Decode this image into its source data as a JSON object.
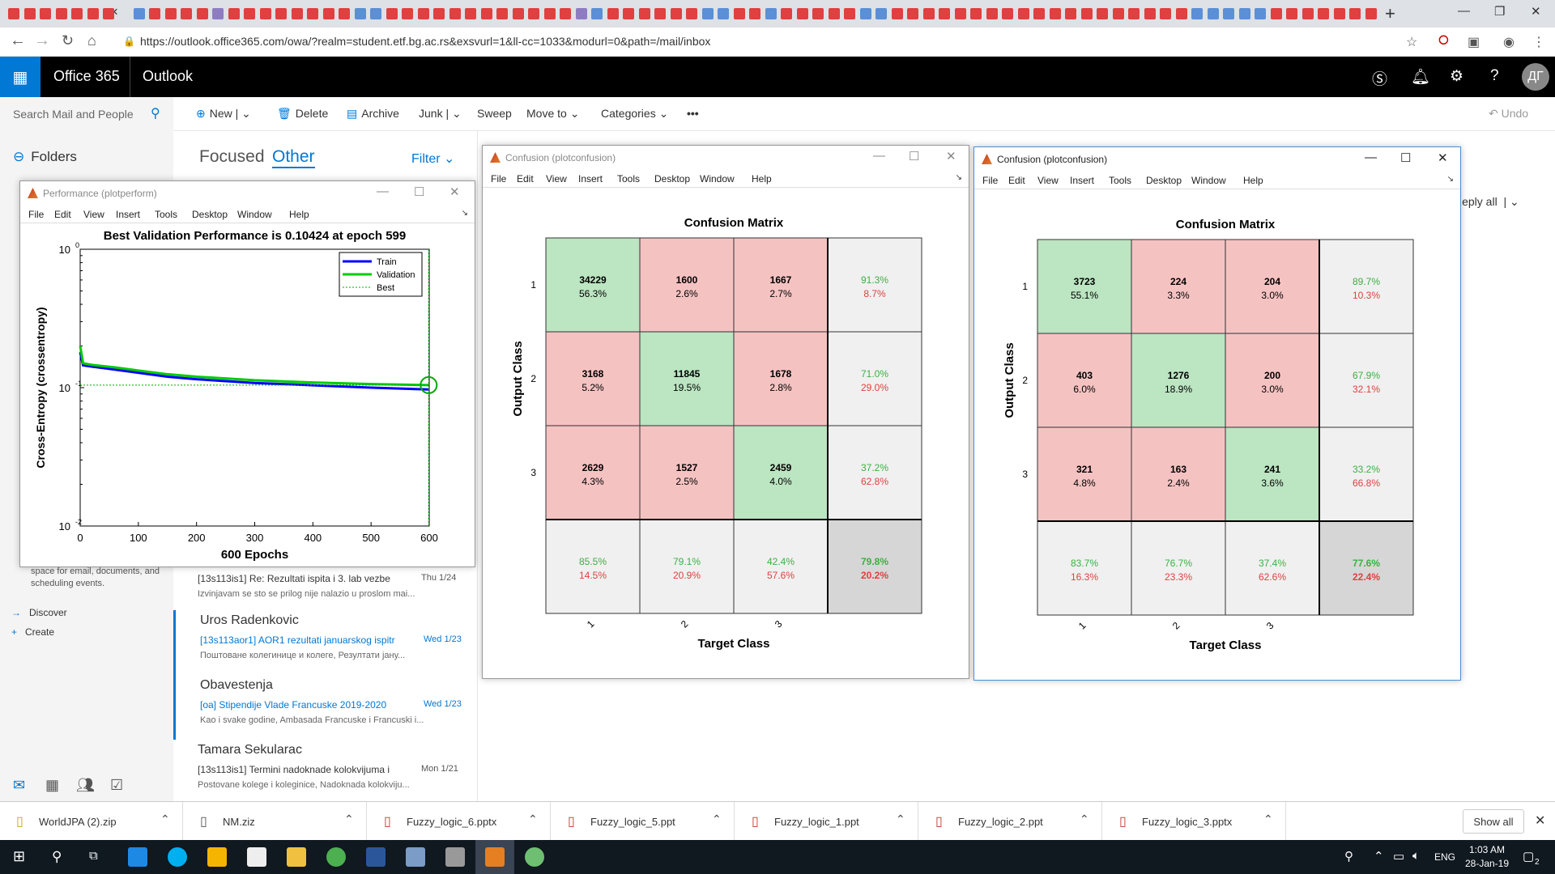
{
  "browser": {
    "url": "https://outlook.office365.com/owa/?realm=student.etf.bg.ac.rs&exsvurl=1&ll-cc=1033&modurl=0&path=/mail/inbox",
    "tab_colors": [
      "#e04040",
      "#e04040",
      "#e04040",
      "#e04040",
      "#e04040",
      "#e04040",
      "#e04040",
      "#5b8fd6",
      "#e04040",
      "#e04040",
      "#e04040",
      "#e04040",
      "#8e7cc3",
      "#e04040",
      "#e04040",
      "#e04040",
      "#e04040",
      "#e04040",
      "#e04040",
      "#e04040",
      "#e04040",
      "#5b8fd6",
      "#5b8fd6",
      "#e04040",
      "#e04040",
      "#e04040",
      "#e04040",
      "#e04040",
      "#e04040",
      "#e04040",
      "#e04040",
      "#e04040",
      "#e04040",
      "#e04040",
      "#e04040",
      "#8e7cc3",
      "#5b8fd6",
      "#e04040",
      "#e04040",
      "#e04040",
      "#e04040",
      "#e04040",
      "#e04040",
      "#5b8fd6",
      "#5b8fd6",
      "#e04040",
      "#e04040",
      "#5b8fd6",
      "#e04040",
      "#e04040",
      "#e04040",
      "#e04040",
      "#e04040",
      "#5b8fd6",
      "#5b8fd6",
      "#e04040",
      "#e04040",
      "#e04040",
      "#e04040",
      "#e04040",
      "#e04040",
      "#e04040",
      "#e04040",
      "#e04040",
      "#e04040",
      "#e04040",
      "#e04040",
      "#e04040",
      "#e04040",
      "#e04040",
      "#e04040",
      "#e04040",
      "#e04040",
      "#e04040",
      "#5b8fd6",
      "#5b8fd6",
      "#5b8fd6",
      "#5b8fd6",
      "#5b8fd6",
      "#e04040",
      "#e04040",
      "#e04040",
      "#e04040",
      "#e04040",
      "#e04040",
      "#e04040",
      "#e04040",
      "#e04040",
      "#e04040",
      "#e04040",
      "#e04040"
    ]
  },
  "o365": {
    "brand": "Office 365",
    "app": "Outlook",
    "avatar_initials": "ДГ"
  },
  "search": {
    "placeholder": "Search Mail and People"
  },
  "commands": {
    "new": "New",
    "delete": "Delete",
    "archive": "Archive",
    "junk": "Junk",
    "sweep": "Sweep",
    "move_to": "Move to",
    "categories": "Categories",
    "more": "•••",
    "undo": "Undo"
  },
  "leftnav": {
    "folders": "Folders",
    "storage_text": "space for email, documents, and scheduling events.",
    "discover": "Discover",
    "create": "Create"
  },
  "msglist": {
    "focused": "Focused",
    "other": "Other",
    "filter": "Filter",
    "messages": [
      {
        "sender": "",
        "subject": "[13s113is1] Re: Rezultati ispita i 3. lab vezbe",
        "date": "Thu 1/24",
        "preview": "Izvinjavam se sto se prilog nije nalazio u proslom mai...",
        "unread": false
      },
      {
        "sender": "Uros Radenkovic",
        "subject": "[13s113aor1] AOR1 rezultati januarskog ispitr",
        "date": "Wed 1/23",
        "preview": "Поштоване колегинице и колеге,  Резултати јану...",
        "unread": true
      },
      {
        "sender": "Obavestenja",
        "subject": "[oa] Stipendije Vlade Francuske 2019-2020",
        "date": "Wed 1/23",
        "preview": "Kao i svake godine, Ambasada Francuske i Francuski i...",
        "unread": true
      },
      {
        "sender": "Tamara Sekularac",
        "subject": "[13s113is1] Termini nadoknade kolokvijuma i",
        "date": "Mon 1/21",
        "preview": "Postovane kolege i koleginice,  Nadoknada kolokviju...",
        "unread": false
      }
    ]
  },
  "reading": {
    "reply_all": "Reply all"
  },
  "downloads": {
    "files": [
      "WorldJPA (2).zip",
      "NM.ziz",
      "Fuzzy_logic_6.pptx",
      "Fuzzy_logic_5.ppt",
      "Fuzzy_logic_1.ppt",
      "Fuzzy_logic_2.ppt",
      "Fuzzy_logic_3.pptx"
    ],
    "show_all": "Show all"
  },
  "taskbar": {
    "lang": "ENG",
    "time": "1:03 AM",
    "date": "28-Jan-19",
    "notif_count": "2"
  },
  "matlab_menu": [
    "File",
    "Edit",
    "View",
    "Insert",
    "Tools",
    "Desktop",
    "Window",
    "Help"
  ],
  "perf_window": {
    "title": "Performance (plotperform)",
    "plot_title": "Best Validation Performance is 0.10424 at epoch 599",
    "ylabel": "Cross-Entropy  (crossentropy)",
    "xlabel": "600 Epochs",
    "xticks": [
      "0",
      "100",
      "200",
      "300",
      "400",
      "500",
      "600"
    ],
    "legend": [
      "Train",
      "Validation",
      "Best"
    ],
    "colors": {
      "train": "#0000ff",
      "validation": "#00cc00",
      "best": "#00aa00"
    }
  },
  "conf_window_1": {
    "title": "Confusion (plotconfusion)",
    "plot_title": "Confusion Matrix",
    "ylabel": "Output Class",
    "xlabel": "Target Class",
    "row_labels": [
      "1",
      "2",
      "3"
    ],
    "col_labels": [
      "1",
      "2",
      "3"
    ],
    "cells": [
      [
        [
          "34229",
          "56.3%"
        ],
        [
          "1600",
          "2.6%"
        ],
        [
          "1667",
          "2.7%"
        ],
        [
          "91.3%",
          "8.7%"
        ]
      ],
      [
        [
          "3168",
          "5.2%"
        ],
        [
          "11845",
          "19.5%"
        ],
        [
          "1678",
          "2.8%"
        ],
        [
          "71.0%",
          "29.0%"
        ]
      ],
      [
        [
          "2629",
          "4.3%"
        ],
        [
          "1527",
          "2.5%"
        ],
        [
          "2459",
          "4.0%"
        ],
        [
          "37.2%",
          "62.8%"
        ]
      ],
      [
        [
          "85.5%",
          "14.5%"
        ],
        [
          "79.1%",
          "20.9%"
        ],
        [
          "42.4%",
          "57.6%"
        ],
        [
          "79.8%",
          "20.2%"
        ]
      ]
    ]
  },
  "conf_window_2": {
    "title": "Confusion (plotconfusion)",
    "plot_title": "Confusion Matrix",
    "ylabel": "Output Class",
    "xlabel": "Target Class",
    "row_labels": [
      "1",
      "2",
      "3"
    ],
    "col_labels": [
      "1",
      "2",
      "3"
    ],
    "cells": [
      [
        [
          "3723",
          "55.1%"
        ],
        [
          "224",
          "3.3%"
        ],
        [
          "204",
          "3.0%"
        ],
        [
          "89.7%",
          "10.3%"
        ]
      ],
      [
        [
          "403",
          "6.0%"
        ],
        [
          "1276",
          "18.9%"
        ],
        [
          "200",
          "3.0%"
        ],
        [
          "67.9%",
          "32.1%"
        ]
      ],
      [
        [
          "321",
          "4.8%"
        ],
        [
          "163",
          "2.4%"
        ],
        [
          "241",
          "3.6%"
        ],
        [
          "33.2%",
          "66.8%"
        ]
      ],
      [
        [
          "83.7%",
          "16.3%"
        ],
        [
          "76.7%",
          "23.3%"
        ],
        [
          "37.4%",
          "62.6%"
        ],
        [
          "77.6%",
          "22.4%"
        ]
      ]
    ]
  },
  "chart_data": [
    {
      "type": "line",
      "title": "Best Validation Performance is 0.10424 at epoch 599",
      "xlabel": "600 Epochs",
      "ylabel": "Cross-Entropy  (crossentropy)",
      "xlim": [
        0,
        600
      ],
      "ylim": [
        0.01,
        1
      ],
      "yscale": "log",
      "x": [
        0,
        5,
        20,
        60,
        100,
        150,
        200,
        300,
        400,
        500,
        599
      ],
      "series": [
        {
          "name": "Train",
          "values": [
            0.18,
            0.145,
            0.142,
            0.135,
            0.128,
            0.12,
            0.115,
            0.108,
            0.104,
            0.1,
            0.097
          ]
        },
        {
          "name": "Validation",
          "values": [
            0.2,
            0.15,
            0.146,
            0.14,
            0.133,
            0.125,
            0.12,
            0.113,
            0.109,
            0.106,
            0.10424
          ]
        }
      ],
      "best": {
        "name": "Best",
        "epoch": 599,
        "value": 0.10424
      },
      "legend": "top-right",
      "grid": false
    },
    {
      "type": "heatmap",
      "title": "Confusion Matrix",
      "xlabel": "Target Class",
      "ylabel": "Output Class",
      "categories": [
        "1",
        "2",
        "3"
      ],
      "counts": [
        [
          34229,
          1600,
          1667
        ],
        [
          3168,
          11845,
          1678
        ],
        [
          2629,
          1527,
          2459
        ]
      ]
    },
    {
      "type": "heatmap",
      "title": "Confusion Matrix",
      "xlabel": "Target Class",
      "ylabel": "Output Class",
      "categories": [
        "1",
        "2",
        "3"
      ],
      "counts": [
        [
          3723,
          224,
          204
        ],
        [
          403,
          1276,
          200
        ],
        [
          321,
          163,
          241
        ]
      ]
    }
  ]
}
